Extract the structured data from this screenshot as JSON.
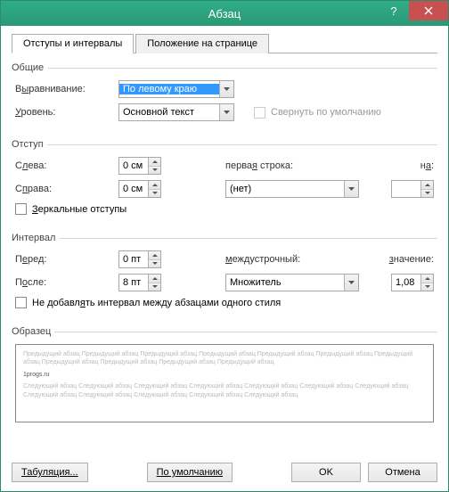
{
  "title": "Абзац",
  "tabs": {
    "t1": "Отступы и интервалы",
    "t2": "Положение на странице"
  },
  "general": {
    "legend": "Общие",
    "alignment_label_pre": "В",
    "alignment_label_u": "ы",
    "alignment_label_post": "равнивание:",
    "alignment_value": "По левому краю",
    "level_label_pre": "",
    "level_label_u": "У",
    "level_label_post": "ровень:",
    "level_value": "Основной текст",
    "collapse_by_default": "Свернуть по умолчанию"
  },
  "indent": {
    "legend": "Отступ",
    "left_pre": "С",
    "left_u": "л",
    "left_post": "ева:",
    "left_value": "0 см",
    "right_pre": "С",
    "right_u": "п",
    "right_post": "рава:",
    "right_value": "0 см",
    "first_line_pre": "перва",
    "first_line_u": "я",
    "first_line_post": " строка:",
    "first_line_value": "(нет)",
    "by_pre": "н",
    "by_u": "а",
    "by_post": ":",
    "by_value": "",
    "mirror_pre": "",
    "mirror_u": "З",
    "mirror_post": "еркальные отступы"
  },
  "spacing": {
    "legend": "Интервал",
    "before_pre": "П",
    "before_u": "е",
    "before_post": "ред:",
    "before_value": "0 пт",
    "after_pre": "П",
    "after_u": "о",
    "after_post": "сле:",
    "after_value": "8 пт",
    "line_pre": "",
    "line_u": "м",
    "line_post": "еждустрочный:",
    "line_value": "Множитель",
    "at_pre": "",
    "at_u": "з",
    "at_post": "начение:",
    "at_value": "1,08",
    "no_space_pre": "Не добавл",
    "no_space_u": "я",
    "no_space_post": "ть интервал между абзацами одного стиля"
  },
  "preview": {
    "legend": "Образец",
    "prev_text": "Предыдущий абзац Предыдущий абзац Предыдущий абзац Предыдущий абзац Предыдущий абзац Предыдущий абзац Предыдущий абзац Предыдущий абзац Предыдущий абзац Предыдущий абзац Предыдущий абзац",
    "sample_text": "1progs.ru",
    "next_text": "Следующий абзац Следующий абзац Следующий абзац Следующий абзац Следующий абзац Следующий абзац Следующий абзац Следующий абзац Следующий абзац Следующий абзац Следующий абзац Следующий абзац"
  },
  "buttons": {
    "tabs_btn": "Табуляция...",
    "default_btn": "По умолчанию",
    "ok": "OK",
    "cancel": "Отмена"
  }
}
